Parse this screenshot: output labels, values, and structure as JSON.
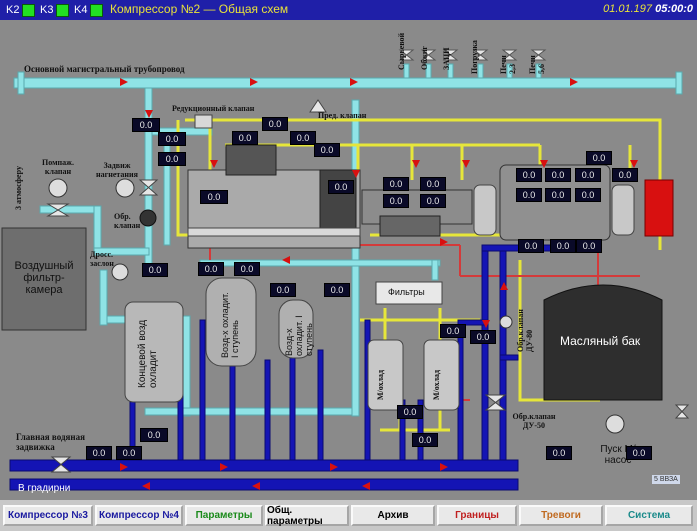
{
  "header": {
    "indicators": [
      {
        "label": "K2"
      },
      {
        "label": "K3"
      },
      {
        "label": "K4"
      }
    ],
    "title": "Компрессор №2 — Общая схем",
    "date": "01.01.197",
    "time": "05:00:0"
  },
  "scheme": {
    "main_pipe_label": "Основной магистральный трубопровод",
    "top_outlets": [
      "Сырьевой",
      "Обжиг",
      "ЗАЦИ",
      "Погрузка",
      "Печи 2,3",
      "Печи 5,6"
    ],
    "atmosphere_label": "3 атмосферу",
    "surge_valve_label": "Помпаж. клапан",
    "suction_gate_label": "Задвиж нагнетания",
    "reduction_valve_label": "Редукционный клапан",
    "safety_valve_label": "Пред. клапан",
    "check_valve_label": "Обр. клапан",
    "throttle_label": "Дросс. заслон",
    "air_filter_label": "Воздушный фильтр-камера",
    "end_cooler_label": "Концевой возд охладит",
    "cooler1_label": "Возд-х охладит. I ступень",
    "cooler2_label": "Возд-х охладит. I ступень",
    "filter_label": "Фильтры",
    "oil_cooler1_label": "М/охлад",
    "oil_cooler2_label": "М/охлад",
    "oil_tank_label": "Масляный бак",
    "check_valve_du80_label": "Обр.клапан ДУ-80",
    "check_valve_du50_label": "Обр.клапан ДУ-50",
    "main_water_gate_label": "Главная водяная задвижка",
    "to_cooling_tower_label": "В градирни",
    "pump_label": "Пуск М/насос",
    "mini_badge": "5 ВВЗА",
    "values": {
      "v1": "0.0",
      "v2": "0.0",
      "v3": "0.0",
      "v4": "0.0",
      "v5": "0.0",
      "v6": "0.0",
      "v7": "0.0",
      "v8": "0.0",
      "v9": "0.0",
      "v10": "0.0",
      "v11": "0.0",
      "v12": "0.0",
      "v13": "0.0",
      "v14": "0.0",
      "v15": "0.0",
      "v16": "0.0",
      "v17": "0.0",
      "v18": "0.0",
      "v19": "0.0",
      "v20": "0.0",
      "v21": "0.0",
      "v22": "0.0",
      "v23": "0.0",
      "v24": "0.0",
      "v25": "0.0",
      "v26": "0.0",
      "v27": "0.0",
      "v28": "0.0",
      "v29": "0.0",
      "v30": "0.0",
      "v31": "0.0",
      "v32": "0.0",
      "v33": "0.0",
      "v34": "0.0",
      "v35": "0.0",
      "v36": "0.0",
      "v37": "0.0",
      "v38": "0.0"
    }
  },
  "footer": {
    "buttons": [
      {
        "label": "Компрессор №3",
        "color": "#1a1aa0"
      },
      {
        "label": "Компрессор №4",
        "color": "#1a1aa0"
      },
      {
        "label": "Параметры",
        "color": "#1a8a1a"
      },
      {
        "label": "Общ. параметры",
        "color": "#000000"
      },
      {
        "label": "Архив",
        "color": "#000000"
      },
      {
        "label": "Границы",
        "color": "#c02020"
      },
      {
        "label": "Тревоги",
        "color": "#c06a20"
      },
      {
        "label": "Система",
        "color": "#1a8a8a"
      }
    ]
  },
  "colors": {
    "cyan_pipe": "#8fe3e6",
    "blue_pipe": "#1414b4",
    "yellow_pipe": "#e6e63a",
    "red_pipe": "#d43a3a",
    "alarm_red": "#d81010"
  }
}
